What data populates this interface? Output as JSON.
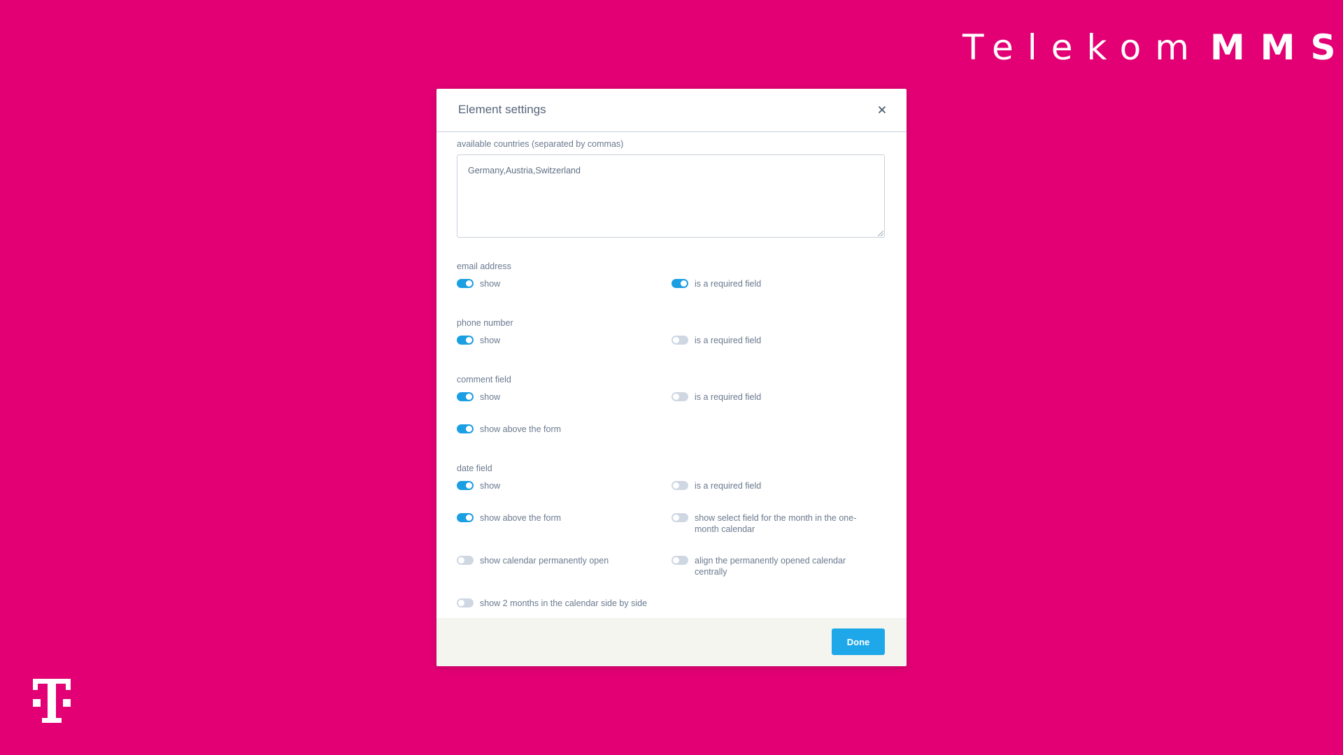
{
  "brand": {
    "text_light": "Telekom",
    "text_bold": "MMS",
    "logo": "telekom-t-logo",
    "background_color": "#e20074"
  },
  "modal": {
    "title": "Element settings",
    "close_icon": "close-icon",
    "countries": {
      "label": "available countries (separated by commas)",
      "value": "Germany,Austria,Switzerland"
    },
    "sections": [
      {
        "label": "email address",
        "options": [
          {
            "label": "show",
            "on": true
          },
          {
            "label": "is a required field",
            "on": true
          }
        ]
      },
      {
        "label": "phone number",
        "options": [
          {
            "label": "show",
            "on": true
          },
          {
            "label": "is a required field",
            "on": false
          }
        ]
      },
      {
        "label": "comment field",
        "options": [
          {
            "label": "show",
            "on": true
          },
          {
            "label": "is a required field",
            "on": false
          },
          {
            "label": "show above the form",
            "on": true
          }
        ]
      },
      {
        "label": "date field",
        "options": [
          {
            "label": "show",
            "on": true
          },
          {
            "label": "is a required field",
            "on": false
          },
          {
            "label": "show above the form",
            "on": true
          },
          {
            "label": "show select field for the month in the one-month calendar",
            "on": false
          },
          {
            "label": "show calendar permanently open",
            "on": false
          },
          {
            "label": "align the permanently opened calendar centrally",
            "on": false
          },
          {
            "label": "show 2 months in the calendar side by side",
            "on": false
          }
        ]
      }
    ],
    "done_label": "Done",
    "accent_color": "#1ea8ea"
  }
}
